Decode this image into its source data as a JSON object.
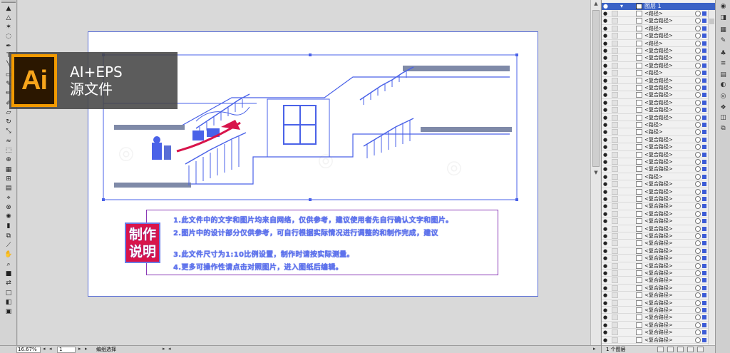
{
  "badge": {
    "logo": "Ai",
    "line1": "AI+EPS",
    "line2": "源文件"
  },
  "notes": {
    "stamp_top": "制作",
    "stamp_bottom": "说明",
    "lines": [
      "1.此文件中的文字和图片均来自网络，仅供参考，建议使用者先自行确认文字和图片。",
      "2.图片中的设计部分仅供参考，可自行根据实际情况进行调整的和制作完成，建议",
      "3.此文件尺寸为1:10比例设置，制作时请按实际测量。",
      "4.更多可操作性请点击对照图片，进入图纸后编辑。"
    ]
  },
  "status": {
    "zoom": "16.67%",
    "page": "1",
    "mode": "编组选择"
  },
  "layers": {
    "header": "图层 1",
    "footer": "1 个图层",
    "rows": [
      "<路径>",
      "<复合路径>",
      "<路径>",
      "<复合路径>",
      "<路径>",
      "<复合路径>",
      "<复合路径>",
      "<复合路径>",
      "<路径>",
      "<复合路径>",
      "<复合路径>",
      "<复合路径>",
      "<复合路径>",
      "<复合路径>",
      "<复合路径>",
      "<路径>",
      "<路径>",
      "<复合路径>",
      "<复合路径>",
      "<复合路径>",
      "<复合路径>",
      "<复合路径>",
      "<路径>",
      "<复合路径>",
      "<复合路径>",
      "<复合路径>",
      "<复合路径>",
      "<复合路径>",
      "<复合路径>",
      "<复合路径>",
      "<复合路径>",
      "<复合路径>",
      "<复合路径>",
      "<复合路径>",
      "<复合路径>",
      "<复合路径>",
      "<复合路径>",
      "<复合路径>",
      "<复合路径>",
      "<复合路径>",
      "<复合路径>",
      "<复合路径>",
      "<复合路径>",
      "<复合路径>",
      "<复合路径>"
    ]
  },
  "tools": [
    {
      "icon": "selection-arrow-icon",
      "glyph": "▲"
    },
    {
      "icon": "direct-selection-icon",
      "glyph": "△"
    },
    {
      "icon": "magic-wand-icon",
      "glyph": "✶"
    },
    {
      "icon": "lasso-icon",
      "glyph": "◌"
    },
    {
      "icon": "pen-icon",
      "glyph": "✒"
    },
    {
      "icon": "type-icon",
      "glyph": "T"
    },
    {
      "icon": "line-segment-icon",
      "glyph": "╲"
    },
    {
      "icon": "rectangle-icon",
      "glyph": "▭"
    },
    {
      "icon": "paintbrush-icon",
      "glyph": "✎"
    },
    {
      "icon": "pencil-icon",
      "glyph": "✏"
    },
    {
      "icon": "blob-brush-icon",
      "glyph": "✐"
    },
    {
      "icon": "eraser-icon",
      "glyph": "▱"
    },
    {
      "icon": "rotate-icon",
      "glyph": "↻"
    },
    {
      "icon": "scale-icon",
      "glyph": "⤡"
    },
    {
      "icon": "warp-icon",
      "glyph": "≈"
    },
    {
      "icon": "free-transform-icon",
      "glyph": "⬚"
    },
    {
      "icon": "shape-builder-icon",
      "glyph": "⊕"
    },
    {
      "icon": "perspective-grid-icon",
      "glyph": "▦"
    },
    {
      "icon": "mesh-icon",
      "glyph": "⊞"
    },
    {
      "icon": "gradient-icon",
      "glyph": "▤"
    },
    {
      "icon": "eyedropper-icon",
      "glyph": "⌖"
    },
    {
      "icon": "blend-icon",
      "glyph": "⊗"
    },
    {
      "icon": "symbol-sprayer-icon",
      "glyph": "✺"
    },
    {
      "icon": "column-graph-icon",
      "glyph": "▮"
    },
    {
      "icon": "artboard-icon",
      "glyph": "⧉"
    },
    {
      "icon": "slice-icon",
      "glyph": "⟋"
    },
    {
      "icon": "hand-icon",
      "glyph": "✋"
    },
    {
      "icon": "zoom-icon",
      "glyph": "⌕"
    },
    {
      "icon": "fill-stroke-icon",
      "glyph": "■"
    },
    {
      "icon": "swap-colors-icon",
      "glyph": "⇄"
    },
    {
      "icon": "color-mode-icon",
      "glyph": "□"
    },
    {
      "icon": "draw-mode-icon",
      "glyph": "◧"
    },
    {
      "icon": "screen-mode-icon",
      "glyph": "▣"
    }
  ],
  "dock": [
    {
      "icon": "color-panel-icon",
      "glyph": "◉"
    },
    {
      "icon": "color-guide-icon",
      "glyph": "◨"
    },
    {
      "icon": "swatches-icon",
      "glyph": "▦"
    },
    {
      "icon": "brushes-icon",
      "glyph": "✎"
    },
    {
      "icon": "symbols-icon",
      "glyph": "♣"
    },
    {
      "icon": "stroke-icon",
      "glyph": "≡"
    },
    {
      "icon": "gradient-panel-icon",
      "glyph": "▤"
    },
    {
      "icon": "transparency-icon",
      "glyph": "◐"
    },
    {
      "icon": "appearance-icon",
      "glyph": "◎"
    },
    {
      "icon": "graphic-styles-icon",
      "glyph": "❖"
    },
    {
      "icon": "layers-panel-icon",
      "glyph": "◫"
    },
    {
      "icon": "artboards-panel-icon",
      "glyph": "⧉"
    }
  ],
  "colors": {
    "selection": "#4a62e8",
    "accent_red": "#d8144b",
    "notes_border": "#8a3ab6",
    "layer_header": "#3a62c6"
  }
}
